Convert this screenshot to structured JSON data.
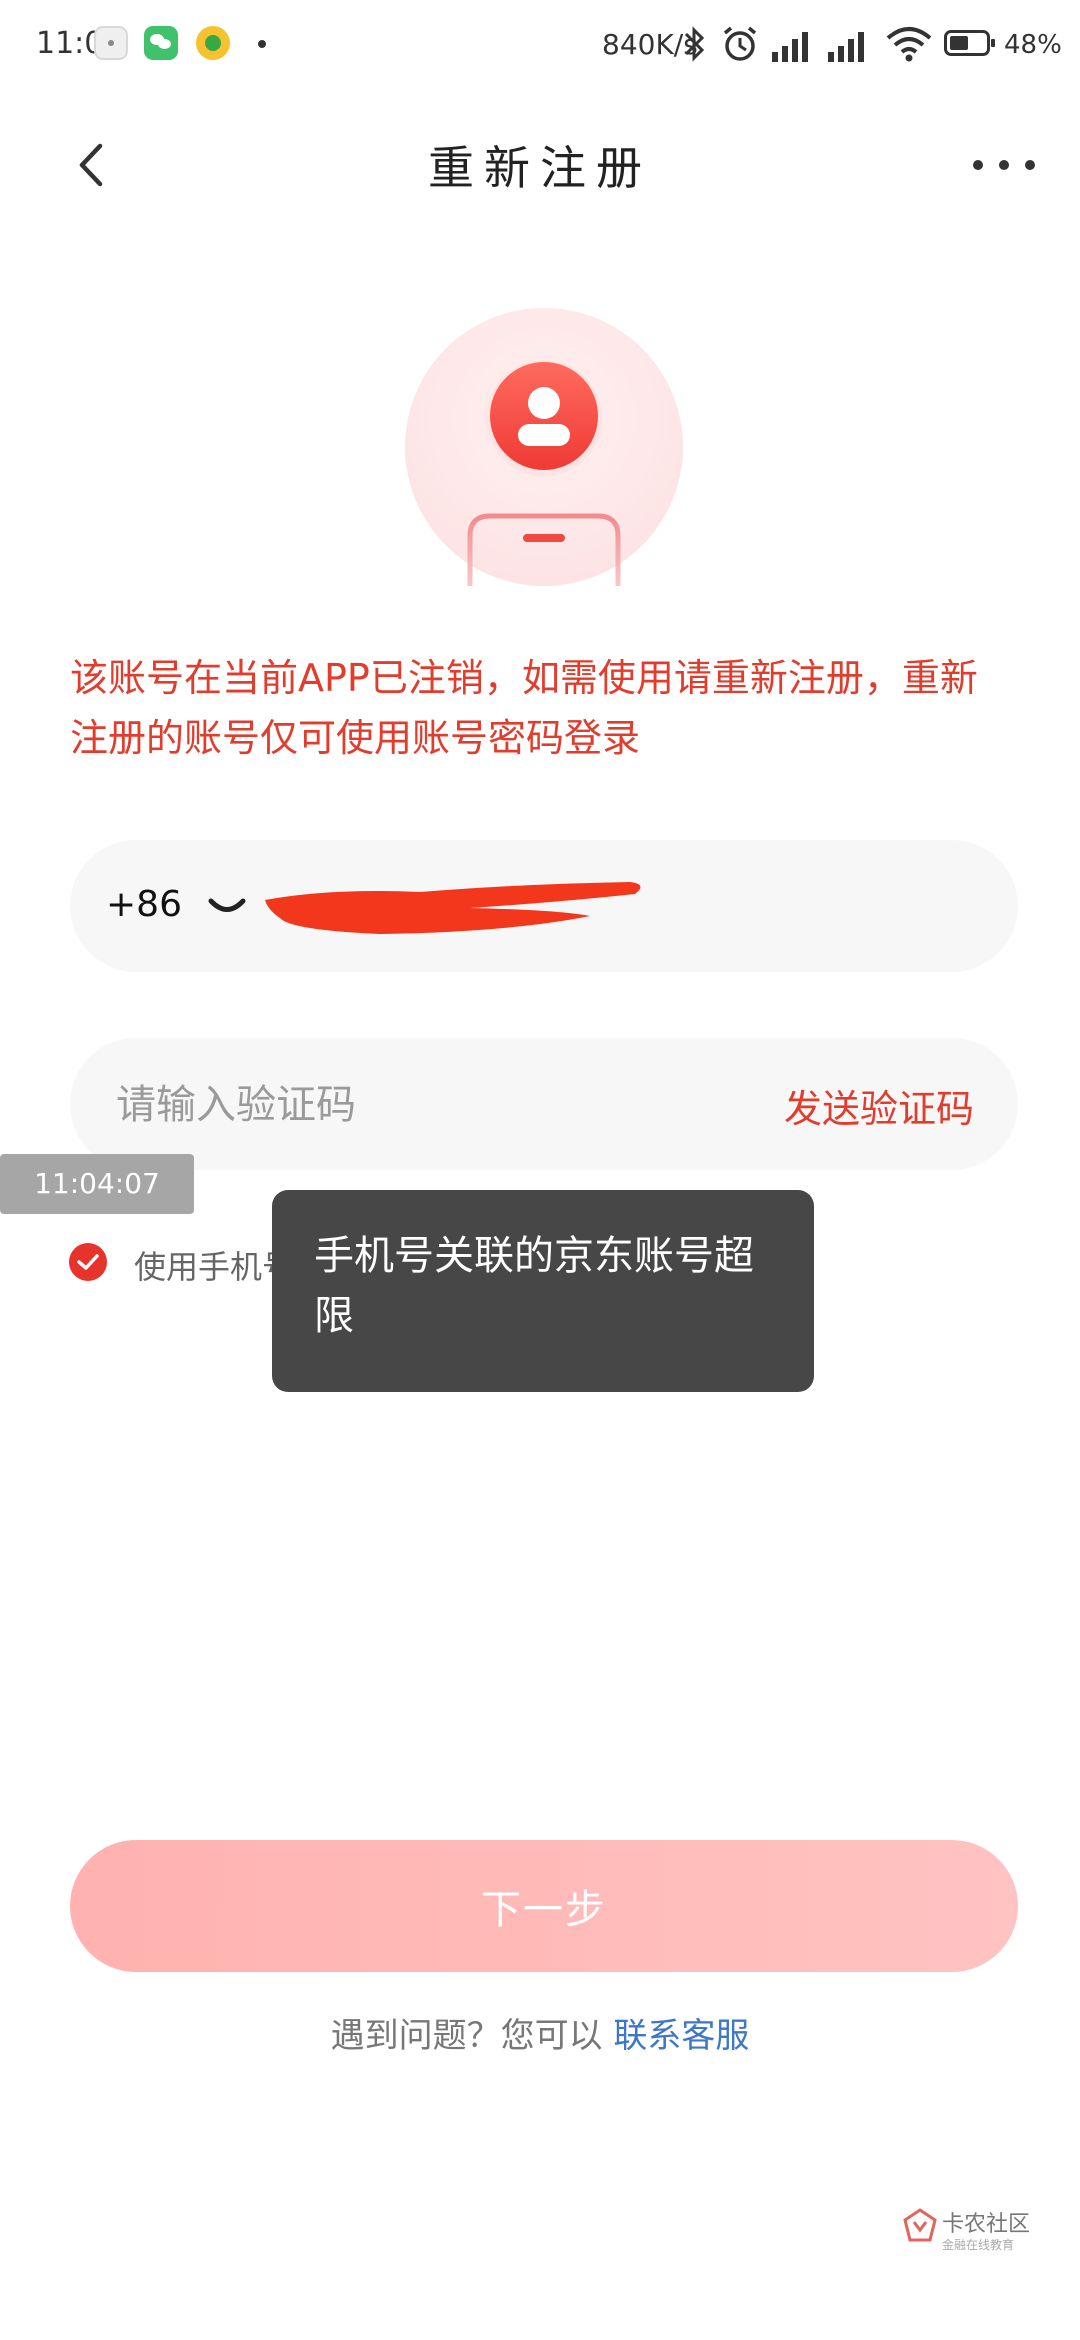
{
  "status_bar": {
    "time": "11:04",
    "net_speed": "840K/s",
    "battery_percent": "48%"
  },
  "header": {
    "title": "重新注册"
  },
  "warning_text": "该账号在当前APP已注销，如需使用请重新注册，重新注册的账号仅可使用账号密码登录",
  "phone": {
    "country_code": "+86"
  },
  "verification": {
    "placeholder": "请输入验证码",
    "send_label": "发送验证码"
  },
  "timestamp_overlay": "11:04:07",
  "agreement": {
    "text": "使用手机号登"
  },
  "toast": {
    "message": "手机号关联的京东账号超限"
  },
  "next_button": {
    "label": "下一步"
  },
  "help": {
    "prefix": "遇到问题？您可以 ",
    "link": "联系客服"
  },
  "watermark": {
    "name": "卡农社区",
    "sub": "金融在线教育"
  },
  "colors": {
    "accent": "#e23c2d",
    "next_button": "#ffbcba",
    "toast_bg": "#474747",
    "link": "#3e76c8"
  },
  "icons": {
    "back": "back-arrow-icon",
    "more": "more-dots-icon",
    "avatar": "user-avatar-icon",
    "chevron": "chevron-down-icon",
    "check": "check-circle-icon"
  }
}
